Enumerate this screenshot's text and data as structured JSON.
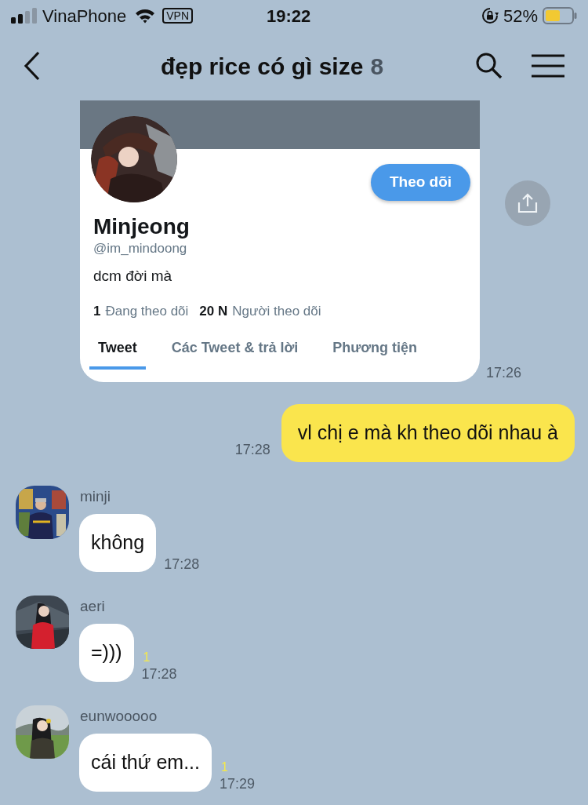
{
  "status_bar": {
    "carrier": "VinaPhone",
    "vpn": "VPN",
    "time": "19:22",
    "battery": "52%"
  },
  "header": {
    "title": "đẹp rice có gì size",
    "member_count": "8"
  },
  "messages": [
    {
      "kind": "card",
      "time": "17:26",
      "card": {
        "name": "Minjeong",
        "handle": "@im_mindoong",
        "bio": "dcm đời mà",
        "follow_button": "Theo dõi",
        "stats": [
          {
            "count": "1",
            "label": "Đang theo dõi"
          },
          {
            "count": "20 N",
            "label": "Người theo dõi"
          }
        ],
        "tabs": [
          {
            "label": "Tweet",
            "selected": true
          },
          {
            "label": "Các Tweet & trả lời",
            "selected": false
          },
          {
            "label": "Phương tiện",
            "selected": false
          }
        ]
      }
    },
    {
      "kind": "outgoing",
      "text": "vl chị e mà kh theo dõi nhau à",
      "time": "17:28"
    },
    {
      "kind": "incoming",
      "sender": "minji",
      "text": "không",
      "time": "17:28"
    },
    {
      "kind": "incoming",
      "sender": "aeri",
      "text": "=)))",
      "unread": "1",
      "time": "17:28"
    },
    {
      "kind": "incoming",
      "sender": "eunwooooo",
      "text": "cái thứ em...",
      "unread": "1",
      "time": "17:29"
    }
  ]
}
